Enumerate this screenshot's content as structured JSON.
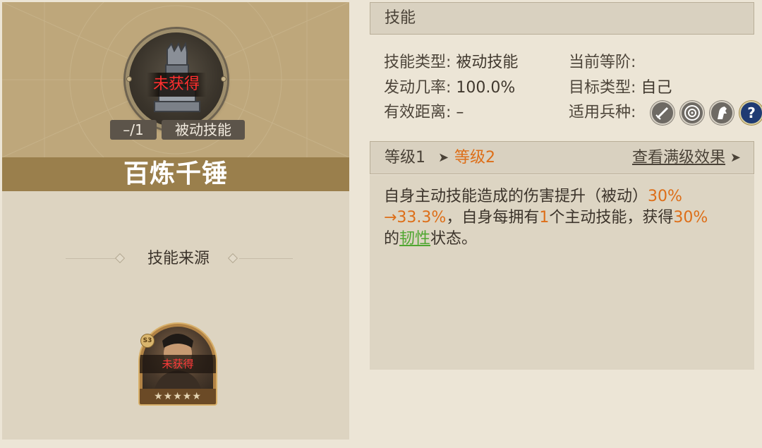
{
  "skill": {
    "name": "百炼千锤",
    "status": "未获得",
    "level_tag": "–/1",
    "type_tag": "被动技能"
  },
  "source": {
    "title": "技能来源",
    "hero": {
      "status": "未获得",
      "stars": "★★★★★",
      "stars_count": 5,
      "badge": "S3"
    }
  },
  "panel": {
    "title": "技能",
    "info": {
      "type_label": "技能类型:",
      "type_value": "被动技能",
      "rate_label": "发动几率:",
      "rate_value": "100.0%",
      "range_label": "有效距离:",
      "range_value": "–",
      "rank_label": "当前等阶:",
      "rank_value": "",
      "target_label": "目标类型:",
      "target_value": "自己",
      "units_label": "适用兵种:"
    },
    "unit_icons": [
      "sword-icon",
      "target-icon",
      "horse-icon",
      "question-icon"
    ]
  },
  "levels": {
    "level1": "等级1",
    "level2": "等级2",
    "max_link": "查看满级效果"
  },
  "description": {
    "p1": "自身主动技能造成的伤害提升（被动）",
    "v1": "30%",
    "v2": "→33.3%",
    "p2": "，自身每拥有",
    "v3": "1",
    "p3": "个主动技能，获得",
    "v4": "30%",
    "p4": "的",
    "status_word": "韧性",
    "p5": "状态。"
  },
  "colors": {
    "highlight": "#dd6e18",
    "status_green": "#4fa631",
    "not_obtained_red": "#ff2f2f"
  }
}
